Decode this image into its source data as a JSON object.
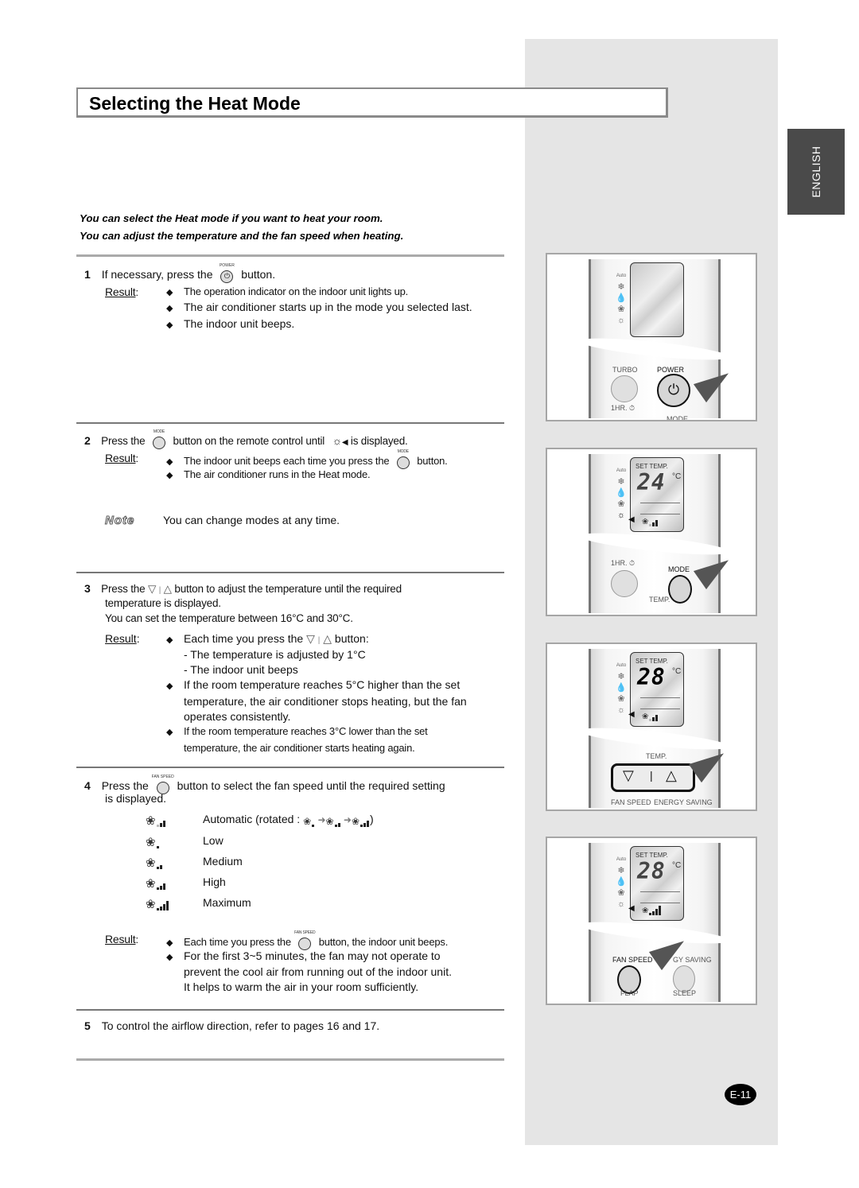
{
  "page": {
    "title": "Selecting the Heat Mode",
    "language_tab": "ENGLISH",
    "page_number": "E-11",
    "colors": {
      "side_panel": "#e5e5e5",
      "language_tab": "#4a4a4a",
      "title_border": "#8a8a8a"
    }
  },
  "intro": [
    "You can select the Heat mode if you want to heat your room.",
    "You can adjust the temperature and the fan speed when heating."
  ],
  "common": {
    "result_label": "Result",
    "result_colon": ":",
    "note_label": "Note",
    "bullet_glyph": "◆",
    "button_caps": {
      "power": "POWER",
      "mode": "MODE",
      "fan_speed": "FAN SPEED"
    },
    "icons": {
      "heat": "☼",
      "heat_arrow": "◀",
      "down": "▽",
      "sep": "|",
      "up": "△",
      "arrow_right": "➜",
      "fan": "❀"
    }
  },
  "steps": [
    {
      "number": "1",
      "text_before": "If necessary, press the",
      "button": "power-button-icon",
      "text_after": "button.",
      "results": [
        "The operation indicator on the indoor unit lights up.",
        "The air conditioner starts up in the mode you selected last.",
        "The indoor unit beeps."
      ]
    },
    {
      "number": "2",
      "text_before": "Press the",
      "text_middle": "button on the remote control until",
      "text_after": "is displayed.",
      "results": [
        {
          "before": "The indoor unit beeps each time you press the",
          "after": "button."
        },
        "The air conditioner runs in the Heat mode."
      ],
      "note": "You can change modes at any time."
    },
    {
      "number": "3",
      "text_before": "Press the",
      "text_after": "button to adjust the temperature until the required",
      "text_line2": "temperature is displayed.",
      "text_line3": "You can set the temperature between 16°C and 30°C.",
      "results": {
        "first_before": "Each time you press the",
        "first_after": "button:",
        "sub": [
          "- The temperature is adjusted by 1°C",
          "- The indoor unit beeps"
        ],
        "second": [
          "If the room temperature reaches 5°C higher than the set",
          "temperature, the air conditioner stops heating, but the fan",
          "operates consistently."
        ],
        "third": [
          "If the room temperature reaches 3°C lower than the set",
          "temperature, the air conditioner starts heating again."
        ]
      }
    },
    {
      "number": "4",
      "text_before": "Press the",
      "text_after": "button to select the fan speed until the required setting",
      "text_line2": "is displayed.",
      "fan_speeds": [
        {
          "label": "Automatic (rotated :",
          "closing": ")",
          "level": "auto"
        },
        {
          "label": "Low",
          "level": 1
        },
        {
          "label": "Medium",
          "level": 2
        },
        {
          "label": "High",
          "level": 3
        },
        {
          "label": "Maximum",
          "level": 4
        }
      ],
      "results": {
        "first_before": "Each time you press the",
        "first_after": "button, the indoor unit beeps.",
        "second": [
          "For the first 3~5 minutes, the fan may not operate to",
          "prevent the cool air from running out of the indoor unit.",
          "It helps to warm the air in your room sufficiently."
        ]
      }
    },
    {
      "number": "5",
      "text": "To control the airflow direction, refer to pages 16 and 17."
    }
  ],
  "remotes": [
    {
      "labels": {
        "left": "TURBO",
        "right": "POWER",
        "left2": "1HR. ⏱",
        "right2": "MODE"
      },
      "display": null
    },
    {
      "labels": {
        "left": "1HR. ⏱",
        "right": "MODE",
        "bottom": "TEMP."
      },
      "display": {
        "set_temp_label": "SET TEMP.",
        "temp": "24",
        "unit": "°C"
      }
    },
    {
      "labels": {
        "bottom": "TEMP.",
        "left": "FAN SPEED",
        "right": "ENERGY SAVING"
      },
      "display": {
        "set_temp_label": "SET TEMP.",
        "temp": "28",
        "unit": "°C"
      }
    },
    {
      "labels": {
        "left": "FAN SPEED",
        "right": "GY SAVING",
        "left2": "FLAP",
        "right2": "SLEEP"
      },
      "display": {
        "set_temp_label": "SET TEMP.",
        "temp": "28",
        "unit": "°C"
      }
    }
  ],
  "remote_modes": [
    "Auto",
    "❄",
    "💧",
    "❀",
    "☼"
  ]
}
